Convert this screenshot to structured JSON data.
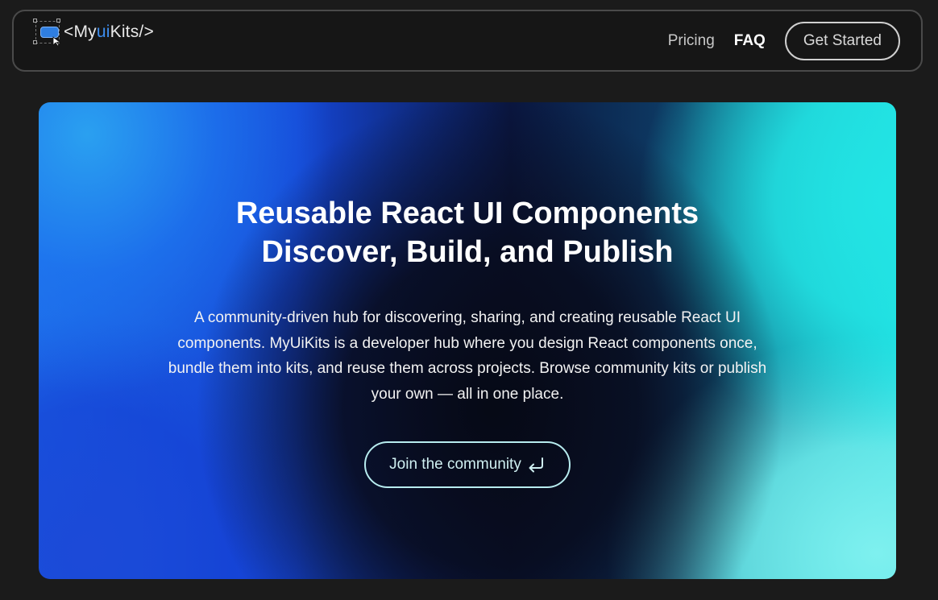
{
  "nav": {
    "logo": {
      "prefix": "<My",
      "accent": "ui",
      "suffix": "Kits/>"
    },
    "links": [
      {
        "label": "Pricing"
      },
      {
        "label": "FAQ"
      }
    ],
    "cta_label": "Get Started"
  },
  "hero": {
    "title_line1": "Reusable React UI Components",
    "title_line2": "Discover, Build, and Publish",
    "description": "A community-driven hub for discovering, sharing, and creating reusable React UI components. MyUiKits is a developer hub where you design React components once, bundle them into kits, and reuse them across projects. Browse community kits or publish your own — all in one place.",
    "button_label": "Join the community",
    "button_icon": "return-arrow-icon"
  },
  "colors": {
    "background": "#1b1b1b",
    "logo_accent": "#3d8ef0",
    "gradient_blue": "#1546d6",
    "gradient_cyan": "#22e4e4"
  }
}
